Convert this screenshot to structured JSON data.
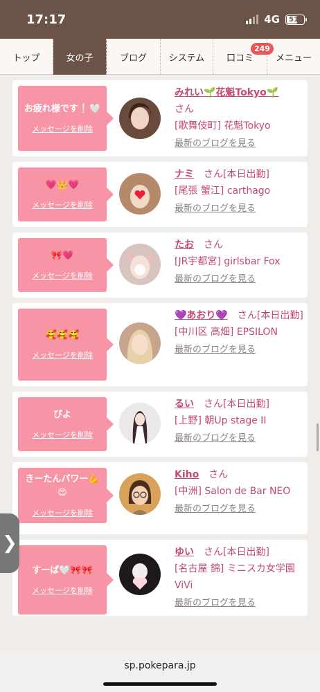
{
  "status": {
    "time": "17:17",
    "network": "4G",
    "battery": "51"
  },
  "nav": {
    "items": [
      {
        "label": "トップ",
        "active": false
      },
      {
        "label": "女の子",
        "active": true
      },
      {
        "label": "ブログ",
        "active": false
      },
      {
        "label": "システム",
        "active": false
      },
      {
        "label": "口コミ",
        "active": false,
        "badge": "249"
      },
      {
        "label": "メニュー",
        "active": false
      }
    ]
  },
  "cards": [
    {
      "message": "お疲れ様です❕🤍",
      "delete_label": "メッセージを削除",
      "name": "みれい🌱花魁Tokyo🌱",
      "suffix": "さん",
      "shop": "[歌舞伎町] 花魁Tokyo",
      "blog_link": "最新のブログを見る",
      "avatar_color": "#6b4a3e"
    },
    {
      "message": "💗👑💗",
      "delete_label": "メッセージを削除",
      "name": "ナミ",
      "suffix": "さん[本日出勤]",
      "shop": "[尾張 蟹江] carthago",
      "blog_link": "最新のブログを見る",
      "avatar_color": "#b58a6a"
    },
    {
      "message": "🎀💗",
      "delete_label": "メッセージを削除",
      "name": "たお",
      "suffix": "さん",
      "shop": "[JR宇都宮] girlsbar Fox",
      "blog_link": "最新のブログを見る",
      "avatar_color": "#d8c4be"
    },
    {
      "message": "🥰🥰🥰",
      "delete_label": "メッセージを削除",
      "name": "💜あおり💜",
      "suffix": "さん[本日出勤]",
      "shop": "[中川区 高畑] EPSILON",
      "blog_link": "最新のブログを見る",
      "avatar_color": "#c9a48c"
    },
    {
      "message": "ぴよ",
      "delete_label": "メッセージを削除",
      "name": "るい",
      "suffix": "さん[本日出勤]",
      "shop": "[上野] 朝Up stage II",
      "blog_link": "最新のブログを見る",
      "avatar_color": "#e6e2e4"
    },
    {
      "message": "きーたんパワー💪😍",
      "delete_label": "メッセージを削除",
      "name": "Kiho",
      "suffix": "さん",
      "shop": "[中洲] Salon de Bar NEO",
      "blog_link": "最新のブログを見る",
      "avatar_color": "#d9a25a"
    },
    {
      "message": "すーぱ🤍🎀🎀",
      "delete_label": "メッセージを削除",
      "name": "ゆい",
      "suffix": "さん[本日出勤]",
      "shop": "[名古屋 錦] ミニスカ女学園ViVi",
      "blog_link": "最新のブログを見る",
      "avatar_color": "#222222"
    }
  ],
  "side_tab_icon": "chevron-right-icon",
  "url": "sp.pokepara.jp"
}
